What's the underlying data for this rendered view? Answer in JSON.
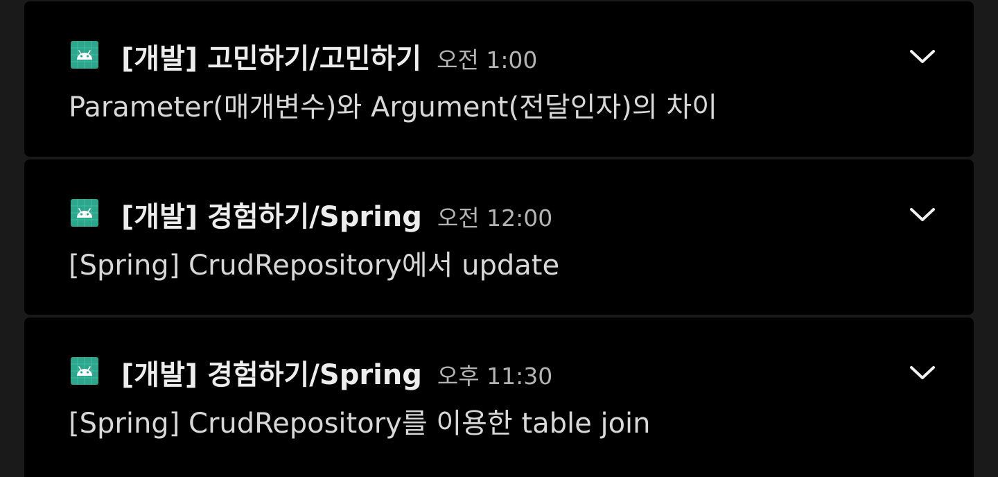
{
  "notifications": [
    {
      "app_icon": "android-icon",
      "title": "[개발] 고민하기/고민하기",
      "time": "오전 1:00",
      "body": "Parameter(매개변수)와 Argument(전달인자)의 차이",
      "expand_icon": "chevron-down-icon"
    },
    {
      "app_icon": "android-icon",
      "title": "[개발] 경험하기/Spring",
      "time": "오전 12:00",
      "body": "[Spring] CrudRepository에서 update",
      "expand_icon": "chevron-down-icon"
    },
    {
      "app_icon": "android-icon",
      "title": "[개발] 경험하기/Spring",
      "time": "오후 11:30",
      "body": "[Spring] CrudRepository를 이용한 table join",
      "expand_icon": "chevron-down-icon"
    }
  ],
  "colors": {
    "background": "#1a1a1a",
    "card": "#000000",
    "icon_teal": "#3ddc84",
    "title": "#ededed",
    "time": "#b4b4b4",
    "body": "#d8d8d8"
  }
}
